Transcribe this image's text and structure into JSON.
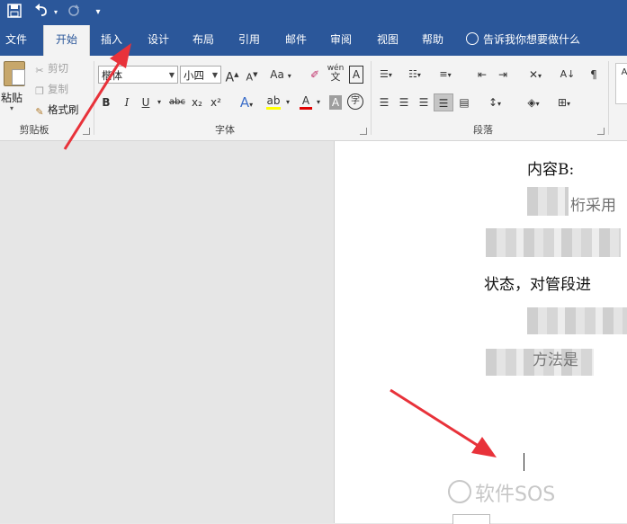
{
  "qat": {
    "save_icon": "save-icon",
    "undo_icon": "undo-icon",
    "redo_icon": "redo-icon",
    "customize_icon": "customize-icon"
  },
  "tabs": [
    {
      "label": "文件"
    },
    {
      "label": "开始"
    },
    {
      "label": "插入"
    },
    {
      "label": "设计"
    },
    {
      "label": "布局"
    },
    {
      "label": "引用"
    },
    {
      "label": "邮件"
    },
    {
      "label": "审阅"
    },
    {
      "label": "视图"
    },
    {
      "label": "帮助"
    }
  ],
  "active_tab": "开始",
  "tell_me": "告诉我你想要做什么",
  "clipboard": {
    "paste": "粘贴",
    "cut": "剪切",
    "copy": "复制",
    "format_painter": "格式刷",
    "group_label": "剪贴板"
  },
  "font": {
    "font_name": "楷体",
    "font_size": "小四",
    "group_label": "字体",
    "bold": "B",
    "italic": "I",
    "underline": "U",
    "strike": "abc",
    "subscript": "x₂",
    "superscript": "x²",
    "grow": "A",
    "shrink": "A",
    "change_case": "Aa",
    "phonetic": "wén",
    "border_char": "A",
    "font_color": "A",
    "shading_char": "A",
    "enclose_char": "字"
  },
  "paragraph": {
    "group_label": "段落"
  },
  "document": {
    "line1": "内容B:",
    "line2": "  ",
    "line3": "状态，对管段进",
    "partial1": "桁采用",
    "partial2": "",
    "partial3": "方法是"
  },
  "watermark": "软件SOS",
  "colors": {
    "ribbon_blue": "#2b579a",
    "arrow_red": "#e8323a",
    "highlight_yellow": "#ffff00",
    "font_red": "#e00000"
  }
}
